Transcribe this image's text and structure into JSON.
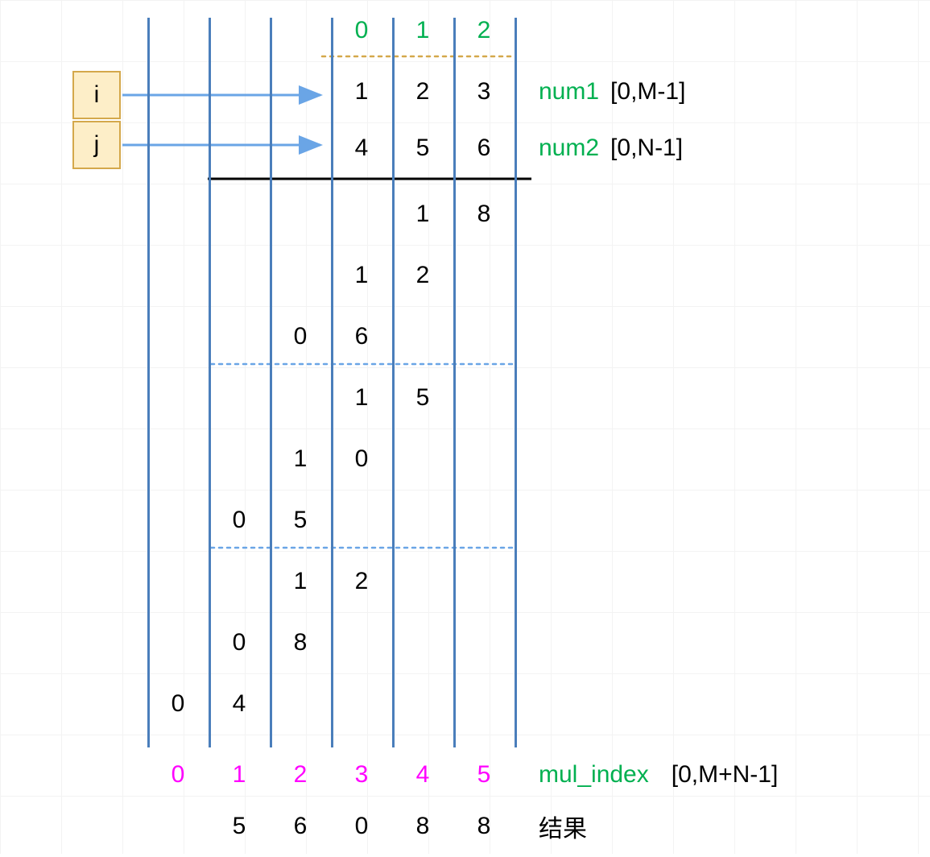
{
  "indices": {
    "i_label": "i",
    "j_label": "j",
    "top_indices": [
      "0",
      "1",
      "2"
    ],
    "mul_indices": [
      "0",
      "1",
      "2",
      "3",
      "4",
      "5"
    ]
  },
  "num1": {
    "name": "num1",
    "range": "[0,M-1]",
    "digits": [
      "1",
      "2",
      "3"
    ]
  },
  "num2": {
    "name": "num2",
    "range": "[0,N-1]",
    "digits": [
      "4",
      "5",
      "6"
    ]
  },
  "partial_products": {
    "group1": [
      {
        "row": 3,
        "col": 4,
        "vals": [
          "1",
          "8"
        ]
      },
      {
        "row": 4,
        "col": 3,
        "vals": [
          "1",
          "2"
        ]
      },
      {
        "row": 5,
        "col": 2,
        "vals": [
          "0",
          "6"
        ]
      }
    ],
    "group2": [
      {
        "row": 6,
        "col": 3,
        "vals": [
          "1",
          "5"
        ]
      },
      {
        "row": 7,
        "col": 2,
        "vals": [
          "1",
          "0"
        ]
      },
      {
        "row": 8,
        "col": 1,
        "vals": [
          "0",
          "5"
        ]
      }
    ],
    "group3": [
      {
        "row": 9,
        "col": 2,
        "vals": [
          "1",
          "2"
        ]
      },
      {
        "row": 10,
        "col": 1,
        "vals": [
          "0",
          "8"
        ]
      },
      {
        "row": 11,
        "col": 0,
        "vals": [
          "0",
          "4"
        ]
      }
    ]
  },
  "mul_index_label": "mul_index",
  "mul_index_range": "[0,M+N-1]",
  "result_label": "结果",
  "result_digits": [
    "5",
    "6",
    "0",
    "8",
    "8"
  ]
}
